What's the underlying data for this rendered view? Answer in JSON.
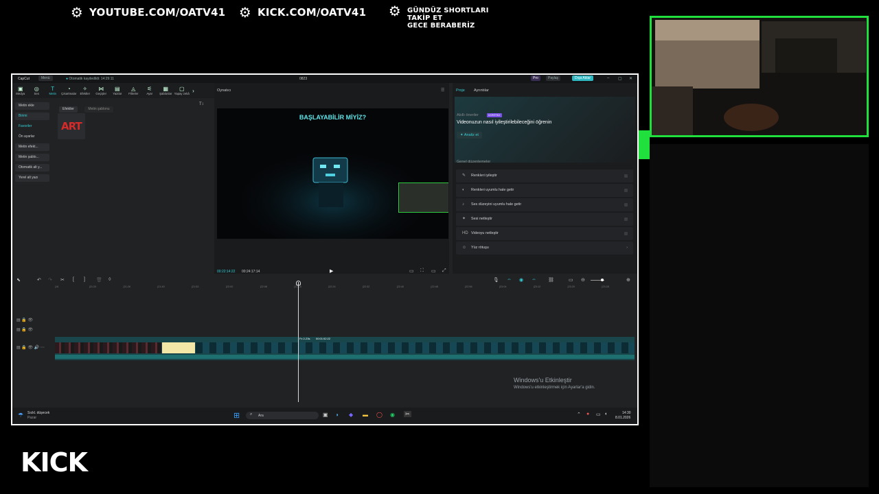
{
  "banner": {
    "youtube": "YOUTUBE.COM/OATV41",
    "kick": "KICK.COM/OATV41",
    "shorts_line1": "GÜNDÜZ SHORTLARI",
    "shorts_line2": "TAKİP ET",
    "shorts_line3": "GECE BERABERİZ"
  },
  "app": {
    "name": "CapCut",
    "menu_label": "Menü",
    "autosave": "Otomatik kaydedildi: 14:29:11",
    "project_name": "0823",
    "pro_badge": "Pro",
    "share_label": "Paylaş",
    "export_label": "Dışa Aktar"
  },
  "toolbar": {
    "items": [
      "Medya",
      "Ses",
      "Metin",
      "Çıkartmalar",
      "Efektler",
      "Geçişler",
      "Yazılar",
      "Filtreler",
      "Ayar",
      "Şablonlar",
      "Yapay zekâ"
    ],
    "active_index": 2
  },
  "sidebar": {
    "items": [
      "Metin ekle",
      "Birimi",
      "Favoriler",
      "Ön ayarlar",
      "Metin efekt...",
      "Metin şablo...",
      "Otomatik alt y...",
      "Yerel alt yazı"
    ]
  },
  "text_panel": {
    "tab_effects": "Efektler",
    "tab_templates": "Metin şablonu",
    "font_toggle": "T↕",
    "tile_text": "ART"
  },
  "player": {
    "label": "Oynatıcı",
    "video_title": "BAŞLAYABİLİR MİYİZ?",
    "current_time": "00:22:14:22",
    "total_time": "00:24:17:14"
  },
  "right_panel": {
    "tab_project": "Proje",
    "tab_details": "Ayrıntılar",
    "suggestions_label": "Akıllı öneriler",
    "suggestions_badge": "ÜCRETSİZ",
    "headline": "Videonuzun nasıl iyileştirilebileceğini öğrenin",
    "analyze_label": "Analiz et",
    "general_label": "Genel düzenlemeler",
    "rows": [
      {
        "icon": "✎",
        "label": "Renkleri iyileştir"
      },
      {
        "icon": "◐",
        "label": "Renkleri uyumlu hale getir"
      },
      {
        "icon": "♪",
        "label": "Ses düzeyini uyumlu hale getir"
      },
      {
        "icon": "✦",
        "label": "Sesi netleştir"
      },
      {
        "icon": "HD",
        "label": "Videoyu netleştir"
      },
      {
        "icon": "☺",
        "label": "Yüz rötuşu"
      }
    ]
  },
  "timeline": {
    "ruler_ticks": [
      "|16",
      "|21:20",
      "|21:26",
      "|21:40",
      "|21:52",
      "|22:00",
      "|22:08",
      "|22:16",
      "|22:24",
      "|22:32",
      "|22:40",
      "|22:48",
      "|22:56",
      "|23:04",
      "|23:12",
      "|23:20",
      "|23:28"
    ],
    "clip_label": "Fx 2-23s",
    "clip_time": "00:01:52:22"
  },
  "windows": {
    "activate_title": "Windows'u Etkinleştir",
    "activate_sub": "Windows'u etkinleştirmek için Ayarlar'a gidin."
  },
  "taskbar": {
    "weather_line1": "Sıckl. düşecek",
    "weather_line2": "Pazar",
    "search_placeholder": "Ara",
    "time": "14:30",
    "date": "8.01.2026"
  },
  "kick_logo": "KICK"
}
